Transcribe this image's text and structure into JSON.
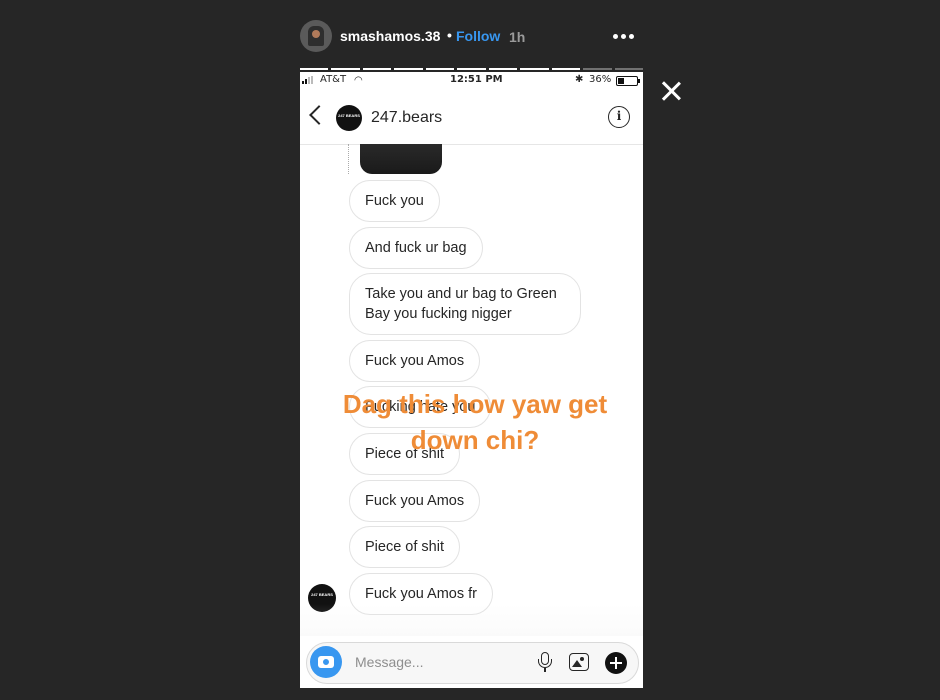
{
  "story": {
    "username": "smashamos.38",
    "separator": "•",
    "follow_label": "Follow",
    "time_ago": "1h",
    "more_icon": "more-horizontal-icon",
    "close_icon": "close-icon",
    "progress": {
      "segments": 11,
      "completed": 9
    }
  },
  "statusbar": {
    "carrier": "AT&T",
    "time": "12:51 PM",
    "bluetooth": "✱",
    "battery_pct": "36%",
    "battery_level": 0.36
  },
  "chat": {
    "title": "247.bears",
    "avatar_text": "247 BEARS",
    "info_glyph": "i"
  },
  "messages": [
    "Fuck you",
    "And fuck ur bag",
    "Take you and ur bag to Green Bay you fucking nigger",
    "Fuck you Amos",
    "Fucking hate you",
    "Piece of shit",
    "Fuck you Amos",
    "Piece of shit",
    "Fuck you Amos fr"
  ],
  "composer": {
    "placeholder": "Message..."
  },
  "overlay": {
    "line1": "Dag this how yaw get",
    "line2": "down chi?",
    "color": "#ef8c37"
  },
  "colors": {
    "accent": "#3897f0",
    "background": "#262626"
  }
}
